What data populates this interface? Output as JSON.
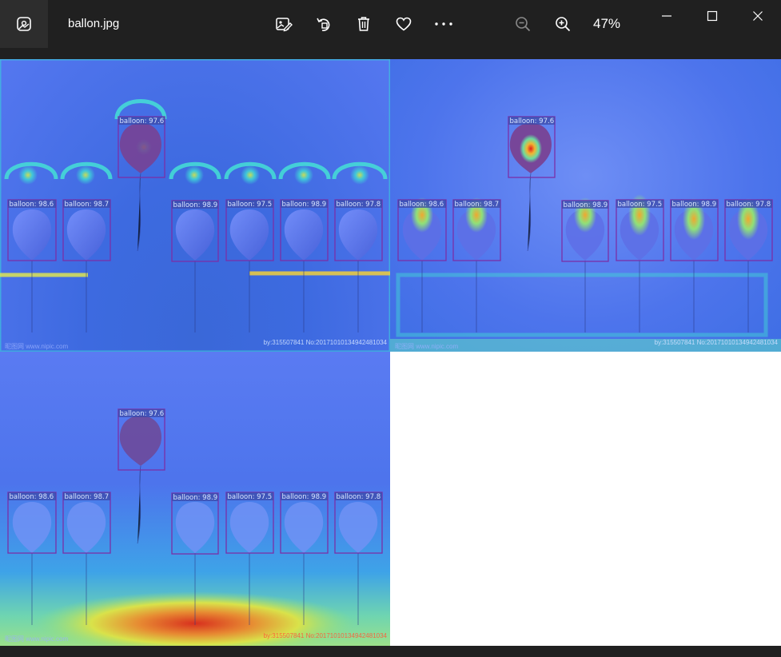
{
  "window": {
    "file_name": "ballon.jpg",
    "zoom_level": "47%"
  },
  "toolbar": {
    "icons": [
      "photos-app-icon",
      "edit-image-icon",
      "rotate-icon",
      "delete-icon",
      "favorite-heart-icon",
      "more-options-icon",
      "zoom-out-icon",
      "zoom-in-icon"
    ]
  },
  "window_controls": [
    "minimize-icon",
    "maximize-icon",
    "close-icon"
  ],
  "colors": {
    "titlebar": "#202020",
    "box": "#7a2fa8",
    "label_bg": "#3c4aa8",
    "label_text": "#d8e4ff"
  },
  "detections": {
    "labels": [
      "balloon: 97.6",
      "balloon: 98.6",
      "balloon: 98.7",
      "balloon: 98.9",
      "balloon: 97.5",
      "balloon: 98.9",
      "balloon: 97.8"
    ]
  },
  "watermark": {
    "left": "昵图网 www.nipic.com",
    "right": "by:315507841 No:20171010134942481034"
  }
}
